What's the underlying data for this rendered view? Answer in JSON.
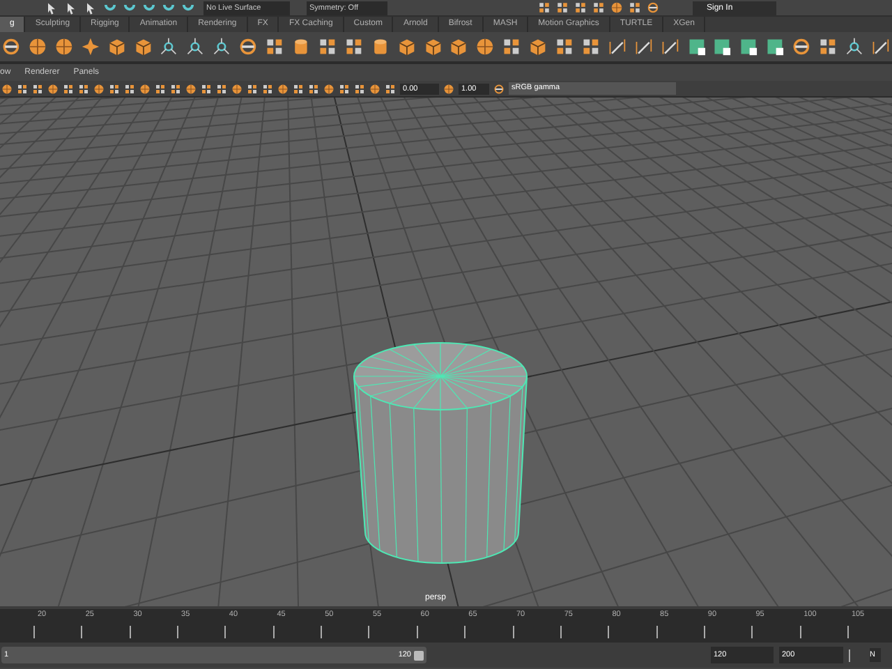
{
  "status_line": {
    "live_surface": "No Live Surface",
    "symmetry": "Symmetry: Off",
    "account": "Sign In"
  },
  "shelf_tabs": [
    {
      "label": "g",
      "selected": true
    },
    {
      "label": "Sculpting",
      "selected": false
    },
    {
      "label": "Rigging",
      "selected": false
    },
    {
      "label": "Animation",
      "selected": false
    },
    {
      "label": "Rendering",
      "selected": false
    },
    {
      "label": "FX",
      "selected": false
    },
    {
      "label": "FX Caching",
      "selected": false
    },
    {
      "label": "Custom",
      "selected": false
    },
    {
      "label": "Arnold",
      "selected": false
    },
    {
      "label": "Bifrost",
      "selected": false
    },
    {
      "label": "MASH",
      "selected": false
    },
    {
      "label": "Motion Graphics",
      "selected": false
    },
    {
      "label": "TURTLE",
      "selected": false
    },
    {
      "label": "XGen",
      "selected": false
    }
  ],
  "panel_menu": [
    "ow",
    "Renderer",
    "Panels"
  ],
  "panel_toolbar": {
    "exposure": "0.00",
    "gamma": "1.00",
    "color_space": "sRGB gamma"
  },
  "viewport": {
    "camera": "persp"
  },
  "time_slider": {
    "ticks": [
      "20",
      "25",
      "30",
      "35",
      "40",
      "45",
      "50",
      "55",
      "60",
      "65",
      "70",
      "75",
      "80",
      "85",
      "90",
      "95",
      "100",
      "105"
    ]
  },
  "range_slider": {
    "start": "1",
    "end": "120",
    "playback_end": "120",
    "animation_end": "200",
    "next_label": "N"
  }
}
